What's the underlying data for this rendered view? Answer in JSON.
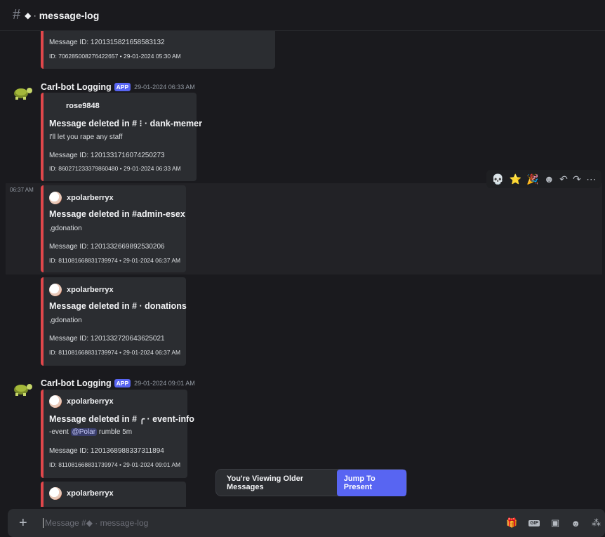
{
  "header": {
    "hash_icon": "#",
    "channel_tag": "◆ ·",
    "channel_name": "message-log"
  },
  "messages": [
    {
      "embed": {
        "message_id": "Message ID: 1201315821658583132",
        "footer": "ID: 706285008276422657 • 29-01-2024 05:30 AM"
      }
    },
    {
      "author": "Carl-bot Logging",
      "badge": "APP",
      "time": "29-01-2024 06:33 AM",
      "embed": {
        "user": "rose9848",
        "title": "Message deleted in # ⁝ · dank-memer",
        "desc": "I'll let you rape any staff",
        "message_id": "Message ID: 1201331716074250273",
        "footer": "ID: 860271233379860480 • 29-01-2024 06:33 AM"
      }
    },
    {
      "side_time": "06:37 AM",
      "embed": {
        "user": "xpolarberryx",
        "title": "Message deleted in #admin-esex",
        "desc": ",gdonation",
        "message_id": "Message ID: 1201332669892530206",
        "footer": "ID: 811081668831739974 • 29-01-2024 06:37 AM"
      }
    },
    {
      "embed": {
        "user": "xpolarberryx",
        "title": "Message deleted in # · donations",
        "desc": ",gdonation",
        "message_id": "Message ID: 1201332720643625021",
        "footer": "ID: 811081668831739974 • 29-01-2024 06:37 AM"
      }
    },
    {
      "author": "Carl-bot Logging",
      "badge": "APP",
      "time": "29-01-2024 09:01 AM",
      "embed": {
        "user": "xpolarberryx",
        "title": "Message deleted in # ╭ · event-info",
        "desc_prefix": "-event",
        "mention": "@Polar",
        "desc_suffix": "rumble 5m",
        "message_id": "Message ID: 1201368988337311894",
        "footer": "ID: 811081668831739974 • 29-01-2024 09:01 AM"
      }
    },
    {
      "embed": {
        "user": "xpolarberryx"
      }
    }
  ],
  "toolbar": {
    "reactions": [
      "💀",
      "⭐",
      "🎉"
    ],
    "add_reaction_icon": "☻",
    "reply_icon": "↶",
    "forward_icon": "↷",
    "more_icon": "⋯"
  },
  "jump_bar": {
    "text": "You're Viewing Older Messages",
    "button": "Jump To Present"
  },
  "composer": {
    "plus": "+",
    "placeholder": "Message #◆ · message-log",
    "gift_icon": "🎁",
    "gif_label": "GIF",
    "sticker_icon": "▣",
    "emoji_icon": "☻",
    "apps_icon": "⁂"
  },
  "colors": {
    "background": "#1a1a1e",
    "embed_bg": "#2b2d31",
    "embed_border": "#e0474b",
    "accent": "#5865f2"
  }
}
